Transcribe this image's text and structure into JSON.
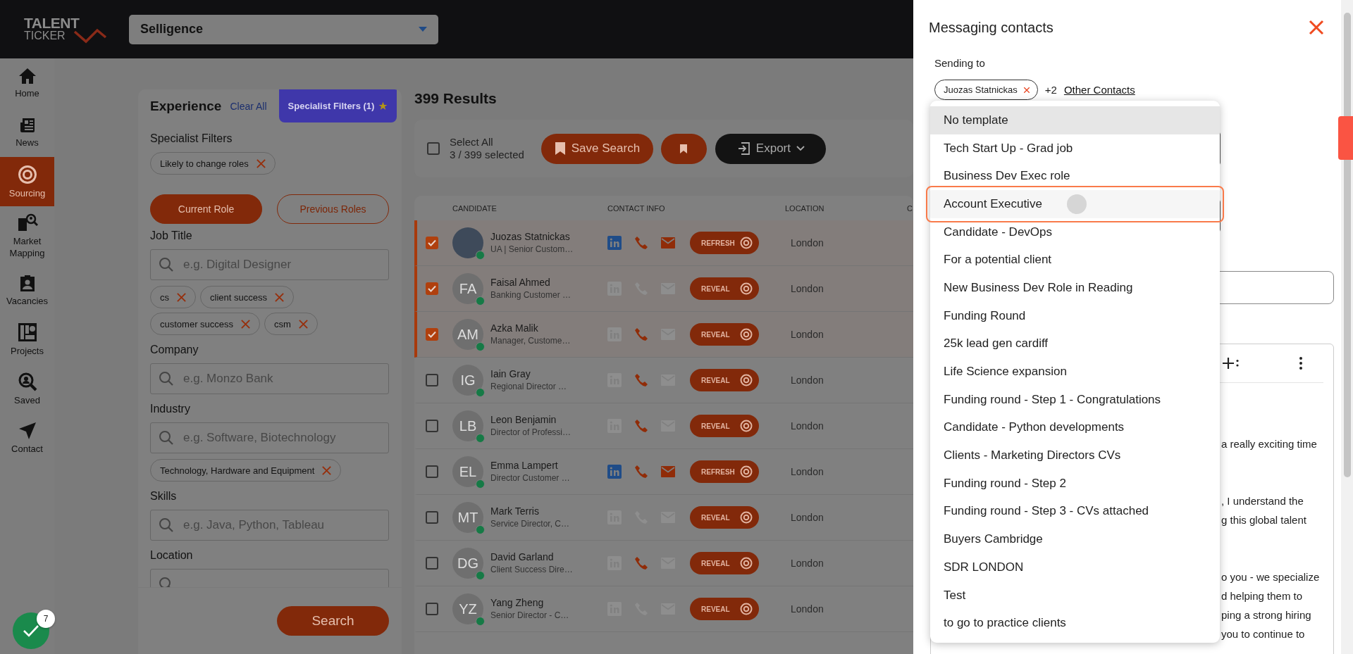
{
  "logo": {
    "line1": "TALENT",
    "line2": "TICKER"
  },
  "workspace_select": {
    "value": "Selligence"
  },
  "nav": [
    {
      "label": "Home",
      "kind": "home",
      "selected": false
    },
    {
      "label": "News",
      "kind": "news",
      "selected": false
    },
    {
      "label": "Sourcing",
      "kind": "target",
      "selected": true
    },
    {
      "label": "Market Mapping",
      "kind": "mapping",
      "selected": false
    },
    {
      "label": "Vacancies",
      "kind": "badge",
      "selected": false
    },
    {
      "label": "Projects",
      "kind": "projects",
      "selected": false
    },
    {
      "label": "Saved",
      "kind": "saved",
      "selected": false
    },
    {
      "label": "Contact",
      "kind": "send",
      "selected": false
    }
  ],
  "help_button": {
    "badge": "7"
  },
  "filters": {
    "title": "Experience",
    "clear": "Clear All",
    "tab": "Specialist Filters (1)",
    "specialist_label": "Specialist Filters",
    "specialist_chips": [
      "Likely to change roles"
    ],
    "role_tabs": [
      {
        "label": "Current Role",
        "selected": true
      },
      {
        "label": "Previous Roles",
        "selected": false
      }
    ],
    "sections": [
      {
        "label": "Job Title",
        "placeholder": "e.g. Digital Designer",
        "chips": [
          "cs",
          "client success",
          "customer success",
          "csm"
        ]
      },
      {
        "label": "Company",
        "placeholder": "e.g. Monzo Bank"
      },
      {
        "label": "Industry",
        "placeholder": "e.g. Software, Biotechnology",
        "chips": [
          "Technology, Hardware and Equipment"
        ]
      },
      {
        "label": "Skills",
        "placeholder": "e.g. Java, Python, Tableau"
      },
      {
        "label": "Location"
      }
    ],
    "search_button": "Search"
  },
  "results": {
    "count": "399 Results",
    "select_all": {
      "label": "Select All",
      "sub": "3 / 399 selected",
      "checked": false
    },
    "save_search": "Save Search",
    "export": "Export",
    "columns": [
      "CANDIDATE",
      "CONTACT INFO",
      "LOCATION",
      "C"
    ],
    "rows": [
      {
        "checked": true,
        "name": "Juozas Statnickas",
        "title": "UA | Senior Custom…",
        "linkedin": true,
        "phone": true,
        "email": true,
        "action": "REFRESH",
        "location": "London"
      },
      {
        "checked": true,
        "initials": "FA",
        "name": "Faisal Ahmed",
        "title": "Banking Customer …",
        "linkedin": false,
        "phone": false,
        "email": false,
        "action": "REVEAL",
        "location": "London"
      },
      {
        "checked": true,
        "initials": "AM",
        "name": "Azka Malik",
        "title": "Manager, Custome…",
        "linkedin": false,
        "phone": true,
        "email": false,
        "action": "REVEAL",
        "location": "London"
      },
      {
        "checked": false,
        "initials": "IG",
        "name": "Iain Gray",
        "title": "Regional Director …",
        "linkedin": false,
        "phone": true,
        "email": false,
        "action": "REVEAL",
        "location": "London"
      },
      {
        "checked": false,
        "initials": "LB",
        "name": "Leon Benjamin",
        "title": "Director of Professi…",
        "linkedin": false,
        "phone": true,
        "email": false,
        "action": "REVEAL",
        "location": "London"
      },
      {
        "checked": false,
        "initials": "EL",
        "name": "Emma Lampert",
        "title": "Director Customer …",
        "linkedin": true,
        "phone": true,
        "email": true,
        "action": "REFRESH",
        "location": "London"
      },
      {
        "checked": false,
        "initials": "MT",
        "name": "Mark Terris",
        "title": "Service Director, C…",
        "linkedin": false,
        "phone": false,
        "email": false,
        "action": "REVEAL",
        "location": "London"
      },
      {
        "checked": false,
        "initials": "DG",
        "name": "David Garland",
        "title": "Client Success Dire…",
        "linkedin": false,
        "phone": true,
        "email": false,
        "action": "REVEAL",
        "location": "London"
      },
      {
        "checked": false,
        "initials": "YZ",
        "name": "Yang Zheng",
        "title": "Senior Director - C…",
        "linkedin": false,
        "phone": false,
        "email": false,
        "action": "REVEAL",
        "location": "London"
      }
    ]
  },
  "drawer": {
    "title": "Messaging contacts",
    "sending_label": "Sending to",
    "recipient": "Juozas Statnickas",
    "more": "+2",
    "more_link": "Other Contacts",
    "templates": [
      {
        "label": "No template",
        "selected": true,
        "focused": false
      },
      {
        "label": "Tech Start Up - Grad job",
        "selected": false,
        "focused": false
      },
      {
        "label": "Business Dev Exec role",
        "selected": false,
        "focused": false
      },
      {
        "label": "Account Executive",
        "selected": false,
        "focused": true
      },
      {
        "label": "Candidate - DevOps",
        "selected": false,
        "focused": false
      },
      {
        "label": "For a potential client",
        "selected": false,
        "focused": false
      },
      {
        "label": "New Business Dev Role in Reading",
        "selected": false,
        "focused": false
      },
      {
        "label": "Funding Round",
        "selected": false,
        "focused": false
      },
      {
        "label": "25k lead gen cardiff",
        "selected": false,
        "focused": false
      },
      {
        "label": "Life Science expansion",
        "selected": false,
        "focused": false
      },
      {
        "label": "Funding round - Step 1 - Congratulations",
        "selected": false,
        "focused": false
      },
      {
        "label": "Candidate - Python developments",
        "selected": false,
        "focused": false
      },
      {
        "label": "Clients - Marketing Directors CVs",
        "selected": false,
        "focused": false
      },
      {
        "label": "Funding round - Step 2",
        "selected": false,
        "focused": false
      },
      {
        "label": "Funding round - Step 3 - CVs attached",
        "selected": false,
        "focused": false
      },
      {
        "label": "Buyers Cambridge",
        "selected": false,
        "focused": false
      },
      {
        "label": "SDR LONDON",
        "selected": false,
        "focused": false
      },
      {
        "label": "Test",
        "selected": false,
        "focused": false
      },
      {
        "label": "to go to practice clients",
        "selected": false,
        "focused": false
      }
    ],
    "editor_paragraphs": [
      [
        "a really exciting time"
      ],
      [
        ", I understand the",
        "g this global talent"
      ],
      [
        "o you - we specialize",
        "d helping them to",
        "ping a strong hiring",
        "you to continue to"
      ]
    ]
  }
}
